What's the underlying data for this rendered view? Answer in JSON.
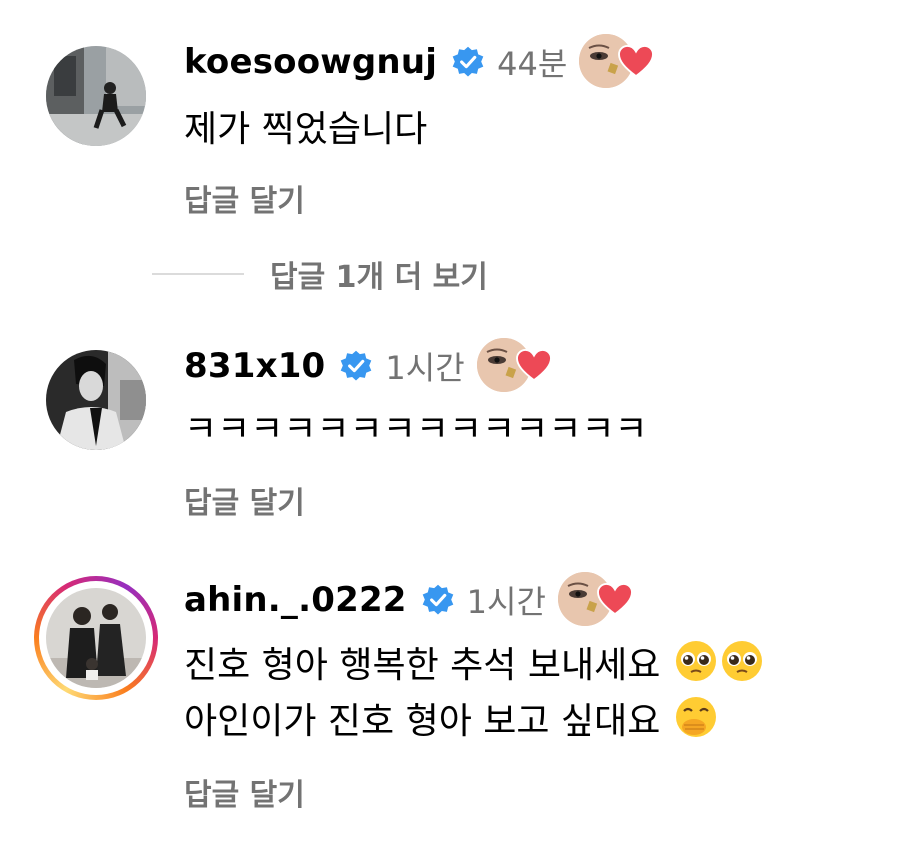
{
  "comments": [
    {
      "username": "koesoowgnuj",
      "time": "44분",
      "text": "제가 찍었습니다",
      "reply_label": "답글 달기",
      "verified": true,
      "has_story_ring": false,
      "liked_by_creator": true
    },
    {
      "username": "831x10",
      "time": "1시간",
      "text": "ㅋㅋㅋㅋㅋㅋㅋㅋㅋㅋㅋㅋㅋㅋ",
      "reply_label": "답글 달기",
      "verified": true,
      "has_story_ring": false,
      "liked_by_creator": true
    },
    {
      "username": "ahin._.0222",
      "time": "1시간",
      "text_line1": "진호 형아 행복한 추석 보내세요",
      "text_line2": "아인이가 진호 형아 보고 싶대요",
      "line1_emojis": [
        "pleading-face-emoji",
        "pleading-face-emoji"
      ],
      "line2_emojis": [
        "face-with-hand-over-mouth-emoji"
      ],
      "reply_label": "답글 달기",
      "verified": true,
      "has_story_ring": true,
      "liked_by_creator": true
    }
  ],
  "view_more_replies": "답글 1개 더 보기",
  "colors": {
    "text": "#000000",
    "secondary": "#737373",
    "verified_badge": "#3897f0",
    "heart": "#ed4956",
    "divider": "#dbdbdb"
  }
}
